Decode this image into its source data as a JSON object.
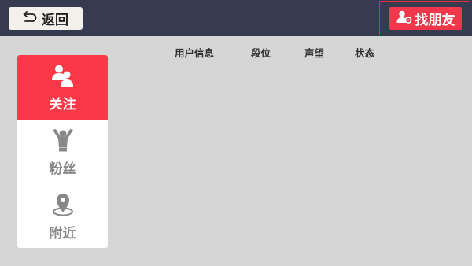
{
  "topbar": {
    "back_label": "返回",
    "find_friends_label": "找朋友"
  },
  "table": {
    "columns": [
      "用户信息",
      "段位",
      "声望",
      "状态"
    ]
  },
  "sidebar": {
    "items": [
      {
        "label": "关注",
        "icon": "two-people-icon",
        "active": true
      },
      {
        "label": "粉丝",
        "icon": "cheering-person-icon",
        "active": false
      },
      {
        "label": "附近",
        "icon": "location-pin-icon",
        "active": false
      }
    ]
  },
  "colors": {
    "topbar_bg": "#363b4f",
    "accent_red": "#fb3848",
    "page_bg": "#d6d6d6"
  }
}
